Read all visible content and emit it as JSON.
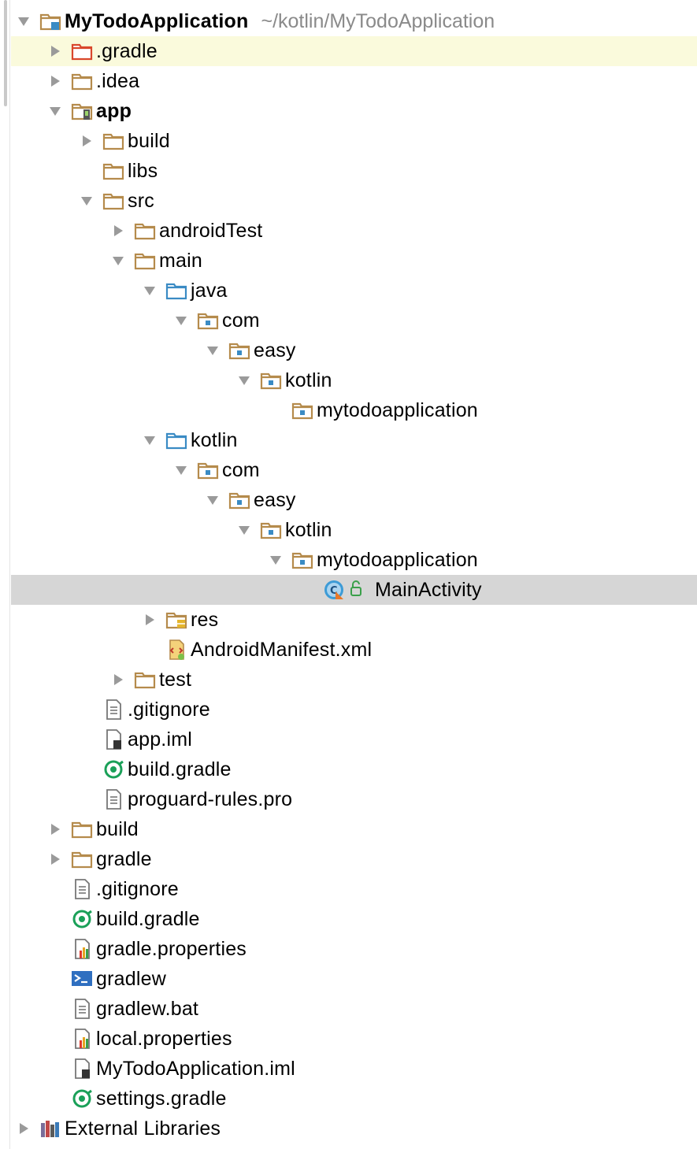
{
  "project": {
    "name": "MyTodoApplication",
    "path": "~/kotlin/MyTodoApplication"
  },
  "tree": [
    {
      "label": "MyTodoApplication",
      "depth": 0,
      "arrow": "down",
      "icon": "project-folder-icon",
      "bold": true,
      "path": "~/kotlin/MyTodoApplication"
    },
    {
      "label": ".gradle",
      "depth": 1,
      "arrow": "right",
      "icon": "excluded-folder-icon",
      "highlight": "yellow"
    },
    {
      "label": ".idea",
      "depth": 1,
      "arrow": "right",
      "icon": "folder-icon"
    },
    {
      "label": "app",
      "depth": 1,
      "arrow": "down",
      "icon": "module-folder-icon",
      "bold": true
    },
    {
      "label": "build",
      "depth": 2,
      "arrow": "right",
      "icon": "folder-icon"
    },
    {
      "label": "libs",
      "depth": 2,
      "arrow": "none",
      "icon": "folder-icon"
    },
    {
      "label": "src",
      "depth": 2,
      "arrow": "down",
      "icon": "folder-icon"
    },
    {
      "label": "androidTest",
      "depth": 3,
      "arrow": "right",
      "icon": "folder-icon"
    },
    {
      "label": "main",
      "depth": 3,
      "arrow": "down",
      "icon": "folder-icon"
    },
    {
      "label": "java",
      "depth": 4,
      "arrow": "down",
      "icon": "source-folder-icon"
    },
    {
      "label": "com",
      "depth": 5,
      "arrow": "down",
      "icon": "package-icon"
    },
    {
      "label": "easy",
      "depth": 6,
      "arrow": "down",
      "icon": "package-icon"
    },
    {
      "label": "kotlin",
      "depth": 7,
      "arrow": "down",
      "icon": "package-icon"
    },
    {
      "label": "mytodoapplication",
      "depth": 8,
      "arrow": "none",
      "icon": "package-icon"
    },
    {
      "label": "kotlin",
      "depth": 4,
      "arrow": "down",
      "icon": "source-folder-icon"
    },
    {
      "label": "com",
      "depth": 5,
      "arrow": "down",
      "icon": "package-icon"
    },
    {
      "label": "easy",
      "depth": 6,
      "arrow": "down",
      "icon": "package-icon"
    },
    {
      "label": "kotlin",
      "depth": 7,
      "arrow": "down",
      "icon": "package-icon"
    },
    {
      "label": "mytodoapplication",
      "depth": 8,
      "arrow": "down",
      "icon": "package-icon"
    },
    {
      "label": "MainActivity",
      "depth": 9,
      "arrow": "none",
      "icon": "kotlin-class-icon",
      "highlight": "gray"
    },
    {
      "label": "res",
      "depth": 4,
      "arrow": "right",
      "icon": "resources-folder-icon"
    },
    {
      "label": "AndroidManifest.xml",
      "depth": 4,
      "arrow": "none",
      "icon": "manifest-file-icon"
    },
    {
      "label": "test",
      "depth": 3,
      "arrow": "right",
      "icon": "folder-icon"
    },
    {
      "label": ".gitignore",
      "depth": 2,
      "arrow": "none",
      "icon": "text-file-icon"
    },
    {
      "label": "app.iml",
      "depth": 2,
      "arrow": "none",
      "icon": "iml-file-icon"
    },
    {
      "label": "build.gradle",
      "depth": 2,
      "arrow": "none",
      "icon": "gradle-file-icon"
    },
    {
      "label": "proguard-rules.pro",
      "depth": 2,
      "arrow": "none",
      "icon": "text-file-icon"
    },
    {
      "label": "build",
      "depth": 1,
      "arrow": "right",
      "icon": "folder-icon"
    },
    {
      "label": "gradle",
      "depth": 1,
      "arrow": "right",
      "icon": "folder-icon"
    },
    {
      "label": ".gitignore",
      "depth": 1,
      "arrow": "none",
      "icon": "text-file-icon"
    },
    {
      "label": "build.gradle",
      "depth": 1,
      "arrow": "none",
      "icon": "gradle-file-icon"
    },
    {
      "label": "gradle.properties",
      "depth": 1,
      "arrow": "none",
      "icon": "properties-file-icon"
    },
    {
      "label": "gradlew",
      "depth": 1,
      "arrow": "none",
      "icon": "shell-script-icon"
    },
    {
      "label": "gradlew.bat",
      "depth": 1,
      "arrow": "none",
      "icon": "text-file-icon"
    },
    {
      "label": "local.properties",
      "depth": 1,
      "arrow": "none",
      "icon": "properties-file-icon"
    },
    {
      "label": "MyTodoApplication.iml",
      "depth": 1,
      "arrow": "none",
      "icon": "iml-file-icon"
    },
    {
      "label": "settings.gradle",
      "depth": 1,
      "arrow": "none",
      "icon": "gradle-file-icon"
    },
    {
      "label": "External Libraries",
      "depth": 0,
      "arrow": "right",
      "icon": "libraries-icon"
    }
  ],
  "colors": {
    "folder": "#b58b4c",
    "excluded_folder": "#d9472b",
    "source_folder": "#3a8bc4",
    "package_dot": "#3a8bc4",
    "gradle": "#1aa058",
    "arrow": "#9a9a9a",
    "path_text": "#8a8a8a",
    "highlight_yellow": "#fafadc",
    "highlight_gray": "#d6d6d6"
  }
}
